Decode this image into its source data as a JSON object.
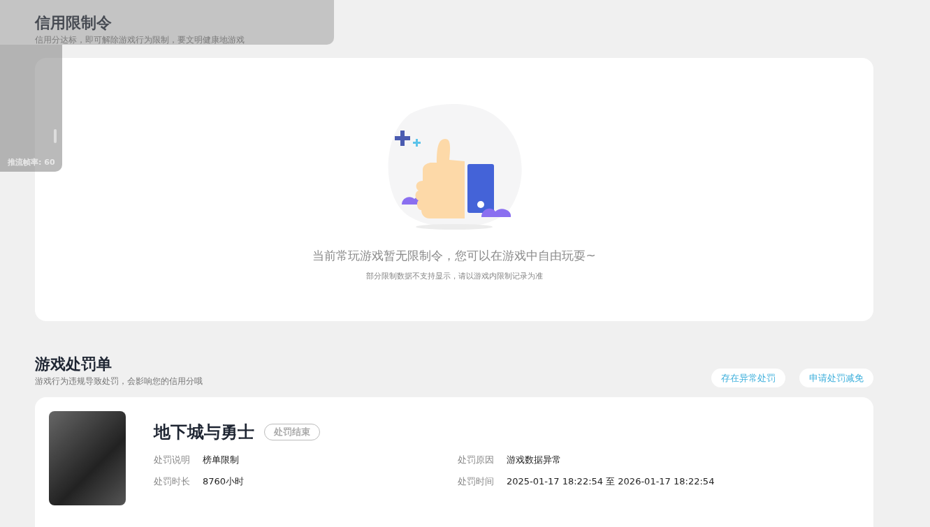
{
  "credit_section": {
    "title": "信用限制令",
    "subtitle": "信用分达标，即可解除游戏行为限制，要文明健康地游戏",
    "empty_message": "当前常玩游戏暂无限制令，您可以在游戏中自由玩耍~",
    "empty_note": "部分限制数据不支持显示，请以游戏内限制记录为准"
  },
  "penalty_section": {
    "title": "游戏处罚单",
    "subtitle": "游戏行为违规导致处罚，会影响您的信用分哦",
    "actions": [
      "存在异常处罚",
      "申请处罚减免"
    ],
    "penalties": [
      {
        "game": "地下城与勇士",
        "status": "处罚结束",
        "fields": [
          {
            "label": "处罚说明",
            "value": "榜单限制"
          },
          {
            "label": "处罚原因",
            "value": "游戏数据异常"
          },
          {
            "label": "处罚时长",
            "value": "8760小时"
          },
          {
            "label": "处罚时间",
            "value": "2025-01-17 18:22:54 至 2026-01-17 18:22:54"
          }
        ]
      }
    ]
  },
  "overlay": {
    "frame_rate_label": "推流帧率: 60"
  }
}
